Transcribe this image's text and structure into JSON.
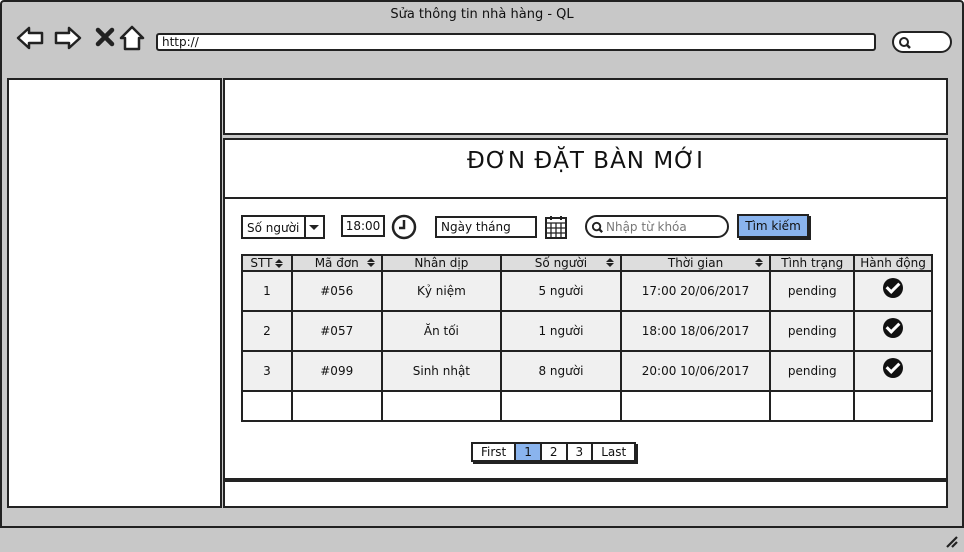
{
  "window": {
    "title": "Sửa thông tin nhà hàng - QL"
  },
  "toolbar": {
    "url": "http://"
  },
  "page": {
    "heading": "ĐƠN ĐẶT BÀN MỚI",
    "filters": {
      "people_select": "Số người",
      "time": "18:00",
      "date": "Ngày tháng",
      "keyword_placeholder": "Nhập từ khóa",
      "search_button": "Tìm kiếm"
    },
    "table": {
      "headers": [
        "STT",
        "Mã đơn",
        "Nhân dịp",
        "Số người",
        "Thời gian",
        "Tình trạng",
        "Hành động"
      ],
      "rows": [
        {
          "stt": "1",
          "code": "#056",
          "occasion": "Kỷ niệm",
          "people": "5 người",
          "time": "17:00 20/06/2017",
          "status": "pending"
        },
        {
          "stt": "2",
          "code": "#057",
          "occasion": "Ăn tối",
          "people": "1 người",
          "time": "18:00 18/06/2017",
          "status": "pending"
        },
        {
          "stt": "3",
          "code": "#099",
          "occasion": "Sinh nhật",
          "people": "8 người",
          "time": "20:00 10/06/2017",
          "status": "pending"
        }
      ]
    },
    "pagination": {
      "first": "First",
      "pages": [
        "1",
        "2",
        "3"
      ],
      "last": "Last",
      "active": "1"
    }
  },
  "icons": {
    "back": "arrow-left-icon",
    "forward": "arrow-right-icon",
    "close": "close-icon",
    "home": "home-icon",
    "search": "search-icon",
    "clock": "clock-icon",
    "calendar": "calendar-icon",
    "action": "check-circle-icon"
  }
}
